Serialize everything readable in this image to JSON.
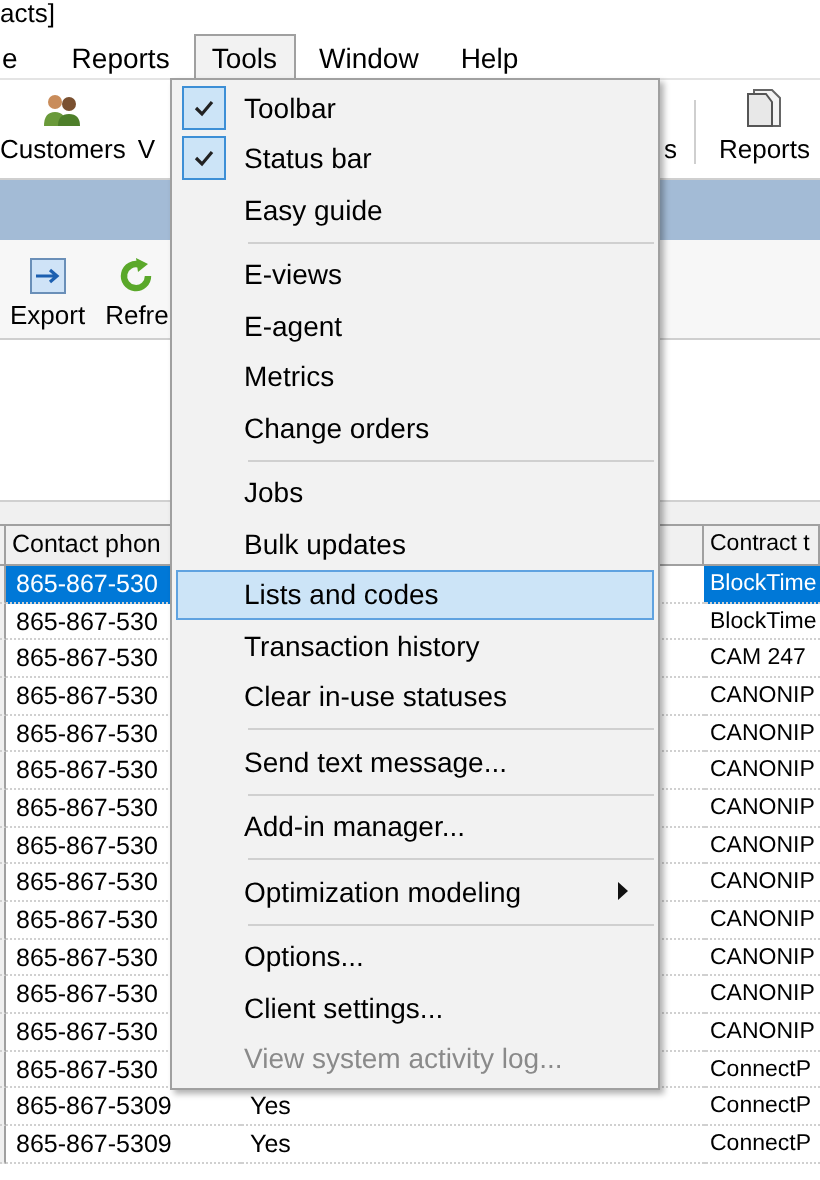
{
  "window": {
    "title": "acts]"
  },
  "menu_bar": [
    {
      "label": "e",
      "selected": false
    },
    {
      "label": "Reports",
      "selected": false
    },
    {
      "label": "Tools",
      "selected": true
    },
    {
      "label": "Window",
      "selected": false
    },
    {
      "label": "Help",
      "selected": false
    }
  ],
  "toolbar": [
    {
      "label": "Customers"
    },
    {
      "label": "V"
    },
    {
      "label": "s"
    },
    {
      "label": "Reports"
    }
  ],
  "sub_toolbar": [
    {
      "label": "Export"
    },
    {
      "label": "Refre"
    }
  ],
  "table": {
    "contact_phone_header": "Contact phon",
    "contract_header": "Contract t",
    "rows": [
      {
        "contact_phone": "865-867-530",
        "contract": "BlockTime",
        "selected": true
      },
      {
        "contact_phone": "865-867-530",
        "contract": "BlockTime",
        "selected": false
      },
      {
        "contact_phone": "865-867-530",
        "contract": "CAM 247",
        "selected": false
      },
      {
        "contact_phone": "865-867-530",
        "contract": "CANONIP",
        "selected": false
      },
      {
        "contact_phone": "865-867-530",
        "contract": "CANONIP",
        "selected": false
      },
      {
        "contact_phone": "865-867-530",
        "contract": "CANONIP",
        "selected": false
      },
      {
        "contact_phone": "865-867-530",
        "contract": "CANONIP",
        "selected": false
      },
      {
        "contact_phone": "865-867-530",
        "contract": "CANONIP",
        "selected": false
      },
      {
        "contact_phone": "865-867-530",
        "contract": "CANONIP",
        "selected": false
      },
      {
        "contact_phone": "865-867-530",
        "contract": "CANONIP",
        "selected": false
      },
      {
        "contact_phone": "865-867-530",
        "contract": "CANONIP",
        "selected": false
      },
      {
        "contact_phone": "865-867-530",
        "contract": "CANONIP",
        "selected": false
      },
      {
        "contact_phone": "865-867-530",
        "contract": "CANONIP",
        "selected": false
      },
      {
        "contact_phone": "865-867-530",
        "contract": "ConnectP",
        "selected": false
      },
      {
        "contact_phone": "865-867-5309",
        "column_3": "Yes",
        "contract": "ConnectP",
        "selected": false
      },
      {
        "contact_phone": "865-867-5309",
        "column_3": "Yes",
        "contract": "ConnectP",
        "selected": false
      }
    ]
  },
  "tools_menu": [
    {
      "kind": "item",
      "label": "Toolbar",
      "checked": true,
      "selected": false,
      "disabled": false,
      "submenu": false
    },
    {
      "kind": "item",
      "label": "Status bar",
      "checked": true,
      "selected": false,
      "disabled": false,
      "submenu": false
    },
    {
      "kind": "item",
      "label": "Easy guide",
      "checked": false,
      "selected": false,
      "disabled": false,
      "submenu": false
    },
    {
      "kind": "separator"
    },
    {
      "kind": "item",
      "label": "E-views",
      "checked": false,
      "selected": false,
      "disabled": false,
      "submenu": false
    },
    {
      "kind": "item",
      "label": "E-agent",
      "checked": false,
      "selected": false,
      "disabled": false,
      "submenu": false
    },
    {
      "kind": "item",
      "label": "Metrics",
      "checked": false,
      "selected": false,
      "disabled": false,
      "submenu": false
    },
    {
      "kind": "item",
      "label": "Change orders",
      "checked": false,
      "selected": false,
      "disabled": false,
      "submenu": false
    },
    {
      "kind": "separator"
    },
    {
      "kind": "item",
      "label": "Jobs",
      "checked": false,
      "selected": false,
      "disabled": false,
      "submenu": false
    },
    {
      "kind": "item",
      "label": "Bulk updates",
      "checked": false,
      "selected": false,
      "disabled": false,
      "submenu": false
    },
    {
      "kind": "item",
      "label": "Lists and codes",
      "checked": false,
      "selected": true,
      "disabled": false,
      "submenu": false
    },
    {
      "kind": "item",
      "label": "Transaction history",
      "checked": false,
      "selected": false,
      "disabled": false,
      "submenu": false
    },
    {
      "kind": "item",
      "label": "Clear in-use statuses",
      "checked": false,
      "selected": false,
      "disabled": false,
      "submenu": false
    },
    {
      "kind": "separator"
    },
    {
      "kind": "item",
      "label": "Send text message...",
      "checked": false,
      "selected": false,
      "disabled": false,
      "submenu": false
    },
    {
      "kind": "separator"
    },
    {
      "kind": "item",
      "label": "Add-in manager...",
      "checked": false,
      "selected": false,
      "disabled": false,
      "submenu": false
    },
    {
      "kind": "separator"
    },
    {
      "kind": "item",
      "label": "Optimization modeling",
      "checked": false,
      "selected": false,
      "disabled": false,
      "submenu": true
    },
    {
      "kind": "separator"
    },
    {
      "kind": "item",
      "label": "Options...",
      "checked": false,
      "selected": false,
      "disabled": false,
      "submenu": false
    },
    {
      "kind": "item",
      "label": "Client settings...",
      "checked": false,
      "selected": false,
      "disabled": false,
      "submenu": false
    },
    {
      "kind": "item",
      "label": "View system activity log...",
      "checked": false,
      "selected": false,
      "disabled": true,
      "submenu": false
    }
  ]
}
